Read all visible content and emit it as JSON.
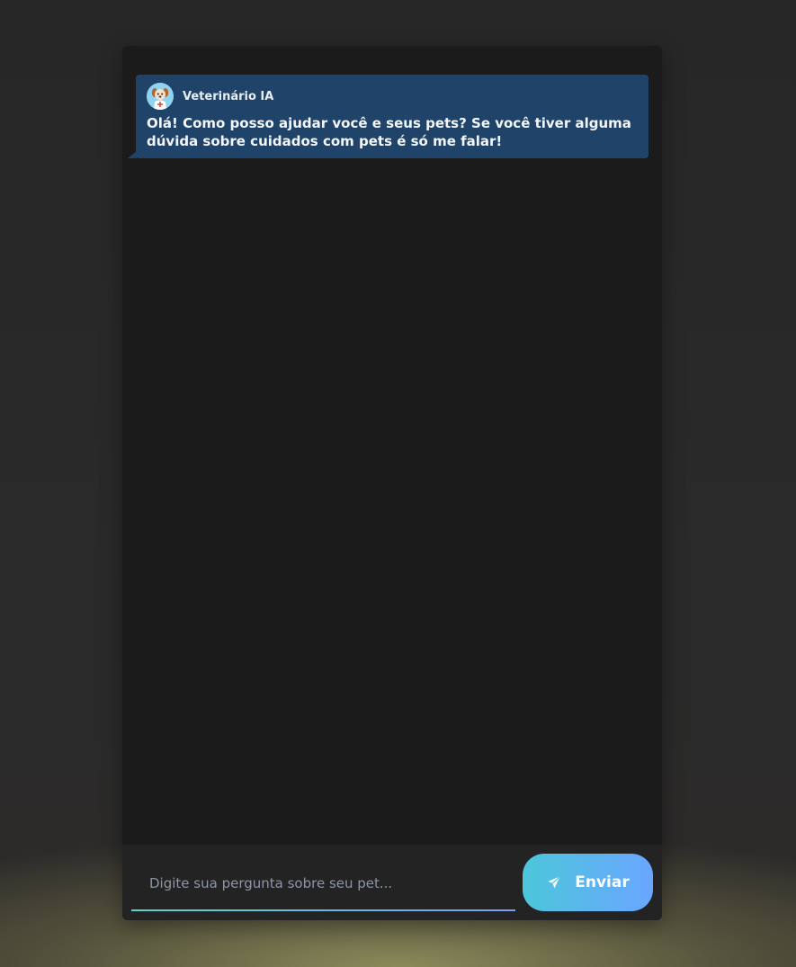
{
  "chat": {
    "message": {
      "sender": "Veterinário IA",
      "avatar_icon": "vet-dog-avatar-icon",
      "text": "Olá! Como posso ajudar você e seus pets? Se você tiver alguma dúvida sobre cuidados com pets é só me falar!"
    }
  },
  "composer": {
    "placeholder": "Digite sua pergunta sobre seu pet...",
    "value": "",
    "send_label": "Enviar",
    "send_icon": "send-icon"
  },
  "colors": {
    "window_bg": "#1b1b1b",
    "bubble_bg": "#1f4369",
    "send_gradient_start": "#4cc6da",
    "send_gradient_end": "#6aa6ff"
  }
}
